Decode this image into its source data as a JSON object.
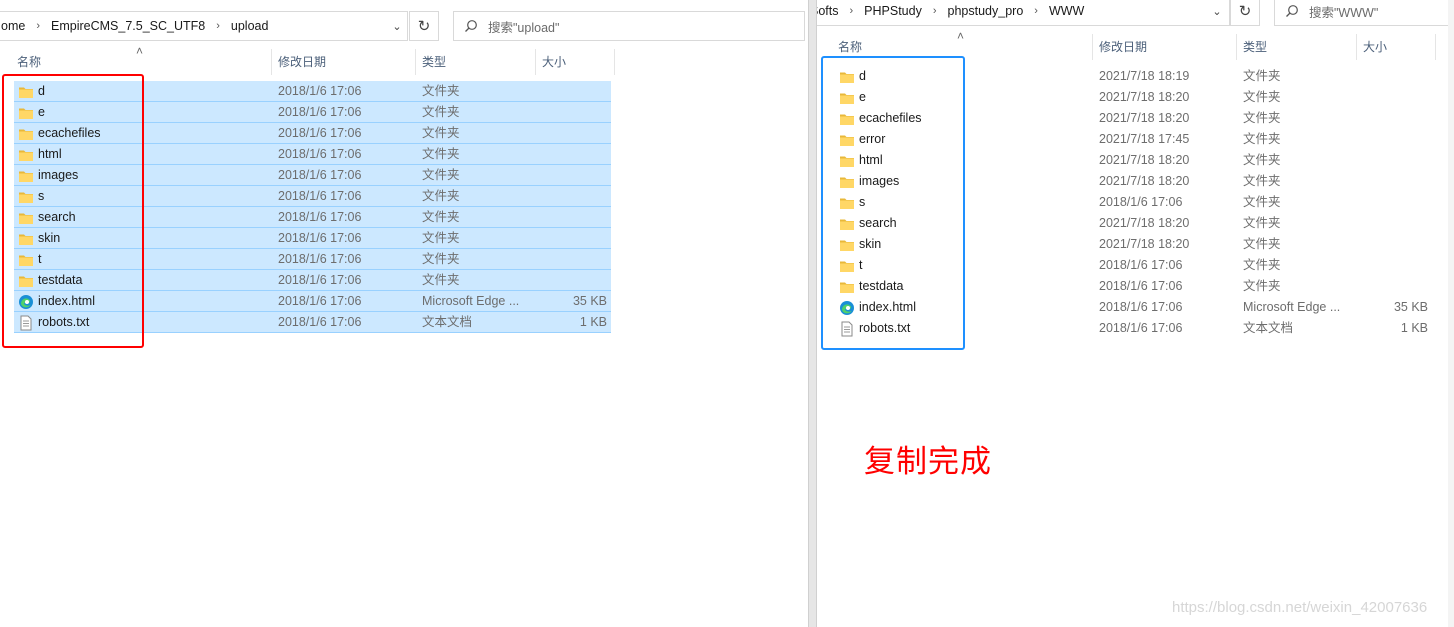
{
  "left": {
    "breadcrumb": [
      "ome",
      "EmpireCMS_7.5_SC_UTF8",
      "upload"
    ],
    "search_placeholder": "搜索\"upload\"",
    "columns": {
      "name": "名称",
      "date": "修改日期",
      "type": "类型",
      "size": "大小"
    },
    "items": [
      {
        "name": "d",
        "date": "2018/1/6 17:06",
        "type": "文件夹",
        "size": "",
        "icon": "folder"
      },
      {
        "name": "e",
        "date": "2018/1/6 17:06",
        "type": "文件夹",
        "size": "",
        "icon": "folder"
      },
      {
        "name": "ecachefiles",
        "date": "2018/1/6 17:06",
        "type": "文件夹",
        "size": "",
        "icon": "folder"
      },
      {
        "name": "html",
        "date": "2018/1/6 17:06",
        "type": "文件夹",
        "size": "",
        "icon": "folder"
      },
      {
        "name": "images",
        "date": "2018/1/6 17:06",
        "type": "文件夹",
        "size": "",
        "icon": "folder"
      },
      {
        "name": "s",
        "date": "2018/1/6 17:06",
        "type": "文件夹",
        "size": "",
        "icon": "folder"
      },
      {
        "name": "search",
        "date": "2018/1/6 17:06",
        "type": "文件夹",
        "size": "",
        "icon": "folder"
      },
      {
        "name": "skin",
        "date": "2018/1/6 17:06",
        "type": "文件夹",
        "size": "",
        "icon": "folder"
      },
      {
        "name": "t",
        "date": "2018/1/6 17:06",
        "type": "文件夹",
        "size": "",
        "icon": "folder"
      },
      {
        "name": "testdata",
        "date": "2018/1/6 17:06",
        "type": "文件夹",
        "size": "",
        "icon": "folder"
      },
      {
        "name": "index.html",
        "date": "2018/1/6 17:06",
        "type": "Microsoft Edge ...",
        "size": "35 KB",
        "icon": "edge"
      },
      {
        "name": "robots.txt",
        "date": "2018/1/6 17:06",
        "type": "文本文档",
        "size": "1 KB",
        "icon": "txt"
      }
    ]
  },
  "right": {
    "breadcrumb": [
      "Softs",
      "PHPStudy",
      "phpstudy_pro",
      "WWW"
    ],
    "search_placeholder": "搜索\"WWW\"",
    "columns": {
      "name": "名称",
      "date": "修改日期",
      "type": "类型",
      "size": "大小"
    },
    "items": [
      {
        "name": "d",
        "date": "2021/7/18 18:19",
        "type": "文件夹",
        "size": "",
        "icon": "folder"
      },
      {
        "name": "e",
        "date": "2021/7/18 18:20",
        "type": "文件夹",
        "size": "",
        "icon": "folder"
      },
      {
        "name": "ecachefiles",
        "date": "2021/7/18 18:20",
        "type": "文件夹",
        "size": "",
        "icon": "folder"
      },
      {
        "name": "error",
        "date": "2021/7/18 17:45",
        "type": "文件夹",
        "size": "",
        "icon": "folder"
      },
      {
        "name": "html",
        "date": "2021/7/18 18:20",
        "type": "文件夹",
        "size": "",
        "icon": "folder"
      },
      {
        "name": "images",
        "date": "2021/7/18 18:20",
        "type": "文件夹",
        "size": "",
        "icon": "folder"
      },
      {
        "name": "s",
        "date": "2018/1/6 17:06",
        "type": "文件夹",
        "size": "",
        "icon": "folder"
      },
      {
        "name": "search",
        "date": "2021/7/18 18:20",
        "type": "文件夹",
        "size": "",
        "icon": "folder"
      },
      {
        "name": "skin",
        "date": "2021/7/18 18:20",
        "type": "文件夹",
        "size": "",
        "icon": "folder"
      },
      {
        "name": "t",
        "date": "2018/1/6 17:06",
        "type": "文件夹",
        "size": "",
        "icon": "folder"
      },
      {
        "name": "testdata",
        "date": "2018/1/6 17:06",
        "type": "文件夹",
        "size": "",
        "icon": "folder"
      },
      {
        "name": "index.html",
        "date": "2018/1/6 17:06",
        "type": "Microsoft Edge ...",
        "size": "35 KB",
        "icon": "edge"
      },
      {
        "name": "robots.txt",
        "date": "2018/1/6 17:06",
        "type": "文本文档",
        "size": "1 KB",
        "icon": "txt"
      }
    ]
  },
  "annotation": {
    "text": "复制完成",
    "left_box_color": "#ff0000",
    "right_box_color": "#1e90ff"
  },
  "watermark": "https://blog.csdn.net/weixin_42007636",
  "colors": {
    "selection_bg": "#cce8ff",
    "selection_border": "#99d1ff",
    "folder": "#ffd766"
  }
}
